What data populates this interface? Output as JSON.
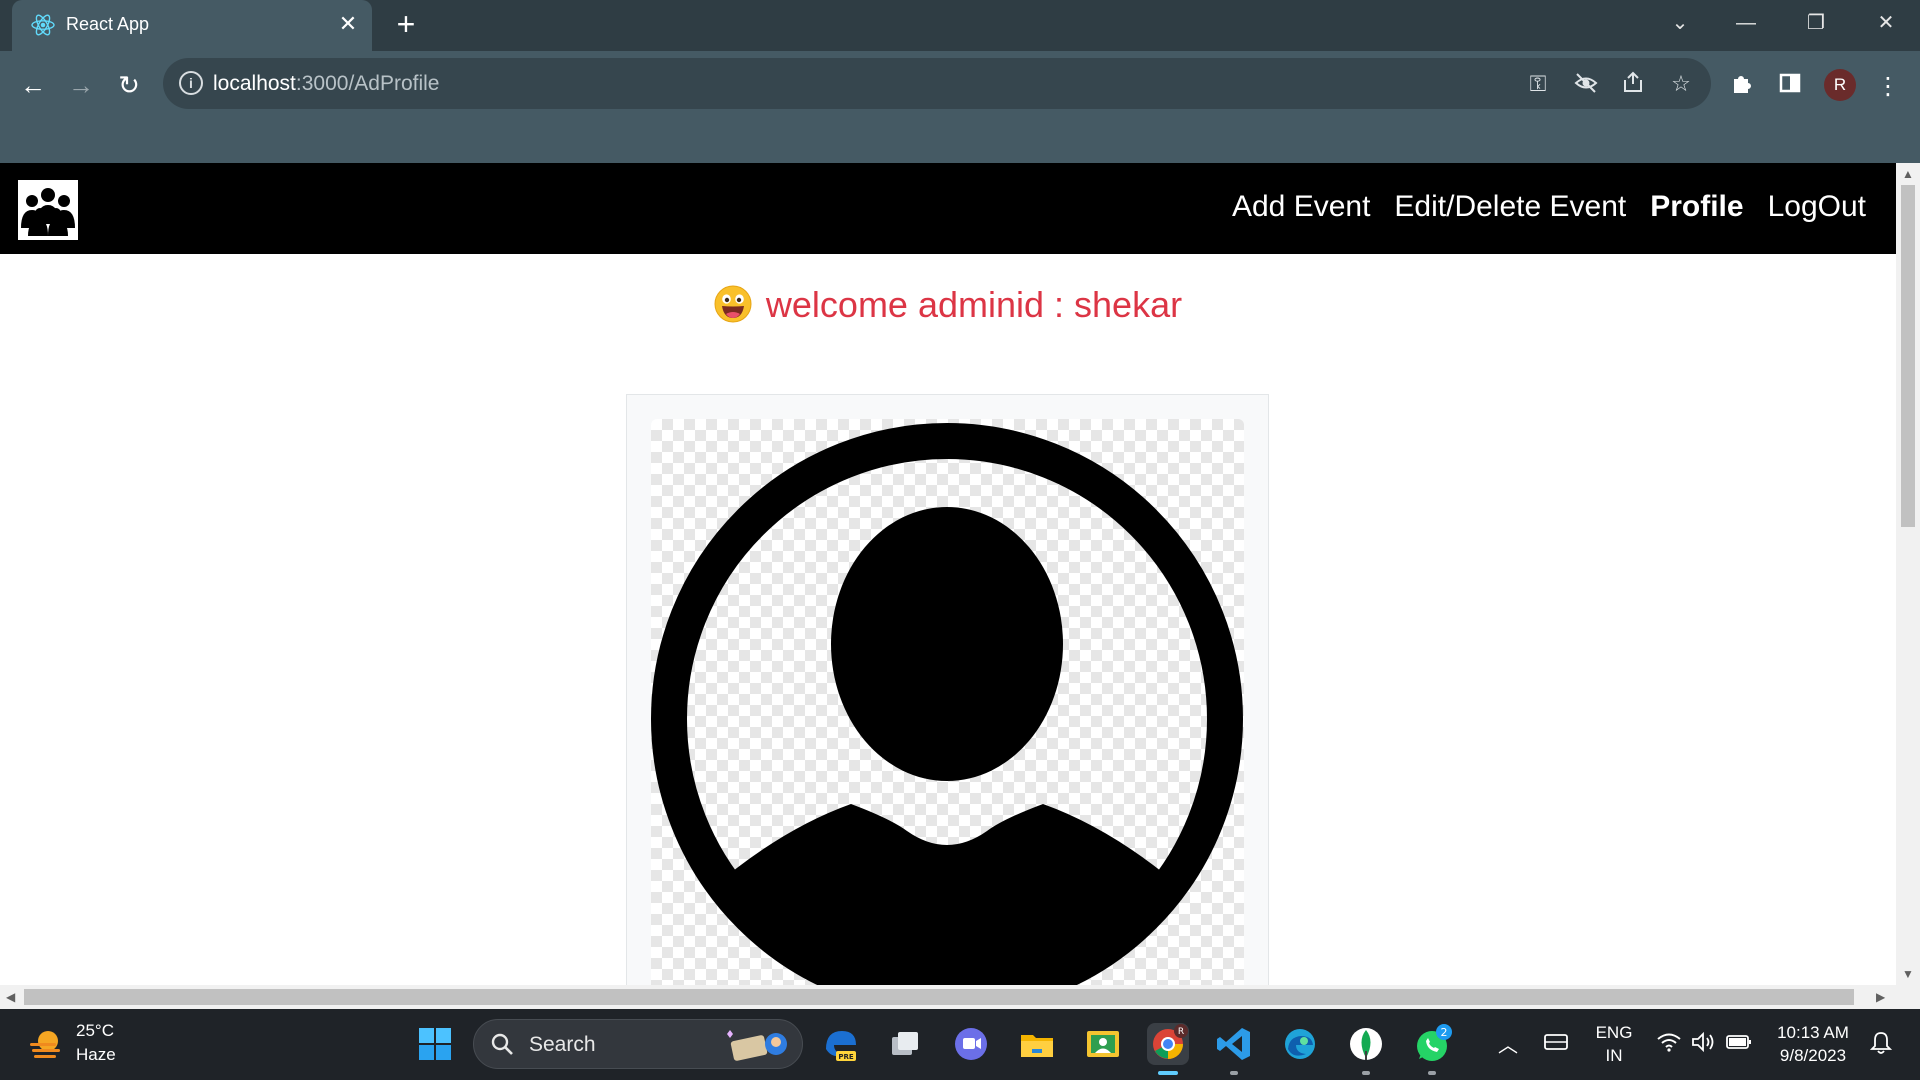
{
  "browser": {
    "tab_title": "React App",
    "url_host": "localhost",
    "url_path": ":3000/AdProfile",
    "profile_initial": "R"
  },
  "navbar": {
    "links": [
      {
        "label": "Add Event",
        "active": false
      },
      {
        "label": "Edit/Delete Event",
        "active": false
      },
      {
        "label": "Profile",
        "active": true
      },
      {
        "label": "LogOut",
        "active": false
      }
    ]
  },
  "main": {
    "welcome_text": "welcome adminid : shekar",
    "colors": {
      "welcome": "#dc3545",
      "navbar_bg": "#000000"
    }
  },
  "taskbar": {
    "weather_temp": "25°C",
    "weather_condition": "Haze",
    "search_label": "Search",
    "lang_primary": "ENG",
    "lang_secondary": "IN",
    "time": "10:13 AM",
    "date": "9/8/2023",
    "chrome_badge": "R",
    "whatsapp_badge": "2"
  }
}
